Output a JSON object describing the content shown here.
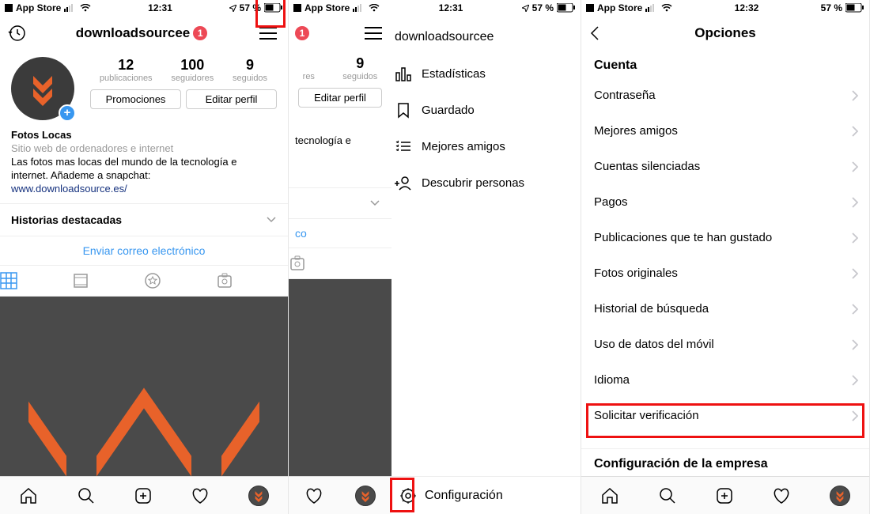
{
  "status": {
    "back_label": "App Store",
    "time1": "12:31",
    "time2": "12:31",
    "time3": "12:32",
    "battery": "57 %"
  },
  "profile": {
    "username": "downloadsourcee",
    "badge": "1",
    "stats": {
      "posts_n": "12",
      "posts_l": "publicaciones",
      "followers_n": "100",
      "followers_l": "seguidores",
      "following_n": "9",
      "following_l": "seguidos"
    },
    "btn_promo": "Promociones",
    "btn_edit": "Editar perfil",
    "name": "Fotos Locas",
    "category": "Sitio web de ordenadores e internet",
    "bio": "Las fotos mas locas del mundo de la tecnología e internet. Añademe a snapchat:",
    "link": "www.downloadsource.es/",
    "highlights": "Historias destacadas",
    "email": "Enviar correo electrónico"
  },
  "slice": {
    "followers_l_cut": "res",
    "following_n": "9",
    "following_l": "seguidos",
    "btn_edit": "Editar perfil",
    "bio_cut": "tecnología e",
    "email_cut": "co"
  },
  "drawer": {
    "title": "downloadsourcee",
    "items": [
      "Estadísticas",
      "Guardado",
      "Mejores amigos",
      "Descubrir personas"
    ],
    "config": "Configuración"
  },
  "options": {
    "title": "Opciones",
    "section": "Cuenta",
    "rows": [
      "Contraseña",
      "Mejores amigos",
      "Cuentas silenciadas",
      "Pagos",
      "Publicaciones que te han gustado",
      "Fotos originales",
      "Historial de búsqueda",
      "Uso de datos del móvil",
      "Idioma",
      "Solicitar verificación"
    ],
    "section2": "Configuración de la empresa"
  }
}
